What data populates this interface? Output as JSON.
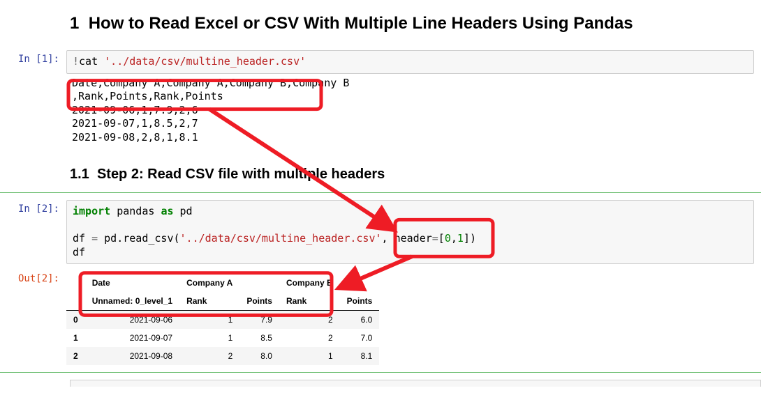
{
  "title_number": "1",
  "title_text": "How to Read Excel or CSV With Multiple Line Headers Using Pandas",
  "cell1": {
    "prompt": "In [1]:",
    "code": {
      "bang": "!",
      "cmd": "cat ",
      "path": "'../data/csv/multine_header.csv'"
    },
    "output": "Date,Company A,Company A,Company B,Company B\n,Rank,Points,Rank,Points\n2021-09-06,1,7.9,2,6\n2021-09-07,1,8.5,2,7\n2021-09-08,2,8,1,8.1"
  },
  "subtitle_number": "1.1",
  "subtitle_text": "Step 2: Read CSV file with multiple headers",
  "cell2": {
    "prompt": "In [2]:",
    "code": {
      "kw1": "import",
      "mod": " pandas ",
      "kw2": "as",
      "alias": " pd",
      "blank": "\n\n",
      "assign_left": "df ",
      "op_eq": "=",
      "call": " pd.read_csv(",
      "arg_path": "'../data/csv/multine_header.csv'",
      "sep": ", header",
      "op_eq2": "=",
      "br_open": "[",
      "n0": "0",
      "comma": ",",
      "n1": "1",
      "br_close": "])",
      "last": "\ndf"
    }
  },
  "cell2_out": {
    "prompt": "Out[2]:",
    "table": {
      "top_headers": [
        "",
        "Date",
        "Company A",
        "",
        "Company B",
        ""
      ],
      "sub_headers": [
        "",
        "Unnamed: 0_level_1",
        "Rank",
        "Points",
        "Rank",
        "Points"
      ],
      "rows": [
        {
          "idx": "0",
          "date": "2021-09-06",
          "a_rank": "1",
          "a_points": "7.9",
          "b_rank": "2",
          "b_points": "6.0"
        },
        {
          "idx": "1",
          "date": "2021-09-07",
          "a_rank": "1",
          "a_points": "8.5",
          "b_rank": "2",
          "b_points": "7.0"
        },
        {
          "idx": "2",
          "date": "2021-09-08",
          "a_rank": "2",
          "a_points": "8.0",
          "b_rank": "1",
          "b_points": "8.1"
        }
      ]
    }
  },
  "annotations": {
    "color": "#ee1c25"
  }
}
